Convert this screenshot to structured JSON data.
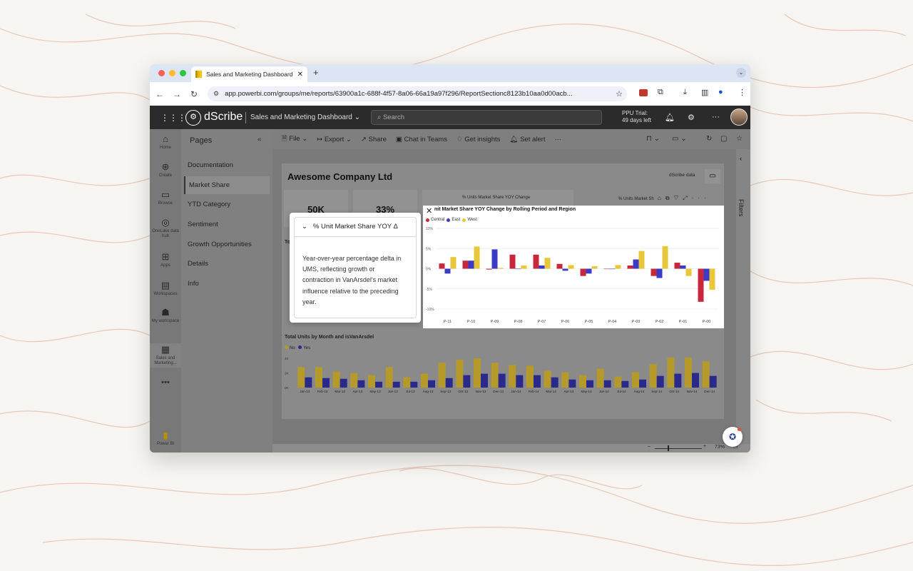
{
  "browser": {
    "tab_title": "Sales and Marketing Dashboard",
    "url": "app.powerbi.com/groups/me/reports/63900a1c-688f-4f57-8a06-66a19a97f296/ReportSectionc8123b10aa0d00acb..."
  },
  "header": {
    "brand": "dScribe",
    "report_name": "Sales and Marketing Dashboard",
    "search_placeholder": "Search",
    "trial_line1": "PPU Trial:",
    "trial_line2": "49 days left"
  },
  "rail": [
    {
      "label": "Home",
      "icon": "home-icon"
    },
    {
      "label": "Create",
      "icon": "create-icon"
    },
    {
      "label": "Browse",
      "icon": "browse-icon"
    },
    {
      "label": "OneLake data hub",
      "icon": "onelake-icon"
    },
    {
      "label": "Apps",
      "icon": "apps-icon"
    },
    {
      "label": "Workspaces",
      "icon": "workspaces-icon"
    },
    {
      "label": "My workspace",
      "icon": "my-workspace-icon"
    },
    {
      "label": "Sales and Marketing...",
      "icon": "report-icon"
    },
    {
      "label": "Power BI",
      "icon": "powerbi-icon"
    }
  ],
  "pages": {
    "title": "Pages",
    "items": [
      "Documentation",
      "Market Share",
      "YTD Category",
      "Sentiment",
      "Growth Opportunities",
      "Details",
      "Info"
    ],
    "active": "Market Share"
  },
  "report_toolbar": {
    "file": "File",
    "export": "Export",
    "share": "Share",
    "chat": "Chat in Teams",
    "insights": "Get insights",
    "alert": "Set alert"
  },
  "report": {
    "company": "Awesome Company Ltd",
    "dscribe_data": "dScribe data",
    "card1_value": "50K",
    "card2_value": "33%",
    "card3_title": "% Units Market Share YOY Change",
    "card4_title": "% Units Market Sh",
    "left_label": "To",
    "bottom_title": "Total Units by Month and isVanArsdel",
    "filters": "Filters",
    "zoom": "73%"
  },
  "tooltip": {
    "header": "% Unit Market Share YOY Δ",
    "description": "Year-over-year percentage delta in UMS, reflecting growth or contraction in VanArsdel's market influence relative to the preceding year."
  },
  "focus_chart": {
    "title": "nit Market Share YOY Change by Rolling Period and Region"
  },
  "colors": {
    "central": "#c8283c",
    "east": "#3b3bc7",
    "west": "#e9c73a",
    "no": "#b59a2a",
    "yes": "#2a2a8c"
  },
  "chart_data": [
    {
      "type": "bar",
      "title": "nit Market Share YOY Change by Rolling Period and Region",
      "categories": [
        "P-11",
        "P-10",
        "P-09",
        "P-08",
        "P-07",
        "P-06",
        "P-05",
        "P-04",
        "P-03",
        "P-02",
        "P-01",
        "P-00"
      ],
      "series": [
        {
          "name": "Central",
          "values": [
            1.3,
            2.0,
            -0.2,
            3.5,
            3.5,
            1.2,
            -1.8,
            0.0,
            0.8,
            -1.8,
            1.5,
            -8.2
          ]
        },
        {
          "name": "East",
          "values": [
            -1.2,
            2.0,
            4.8,
            0.0,
            0.8,
            -0.5,
            -1.2,
            0.0,
            2.3,
            -2.3,
            0.8,
            -3.0
          ]
        },
        {
          "name": "West",
          "values": [
            2.9,
            5.5,
            0.2,
            0.8,
            2.7,
            0.9,
            0.6,
            0.9,
            4.4,
            5.6,
            -1.8,
            -5.2
          ]
        }
      ],
      "yticks": [
        "10%",
        "5%",
        "0%",
        "-5%",
        "-10%"
      ],
      "ylim": [
        -10,
        10
      ]
    },
    {
      "type": "bar",
      "title": "Total Units by Month and isVanArsdel",
      "categories": [
        "Jan-13",
        "Feb-13",
        "Mar-13",
        "Apr-13",
        "May-13",
        "Jun-13",
        "Jul-13",
        "Aug-13",
        "Sep-13",
        "Oct-13",
        "Nov-13",
        "Dec-13",
        "Jan-14",
        "Feb-14",
        "Mar-14",
        "Apr-14",
        "May-14",
        "Jun-14",
        "Jul-14",
        "Aug-14",
        "Sep-14",
        "Oct-14",
        "Nov-14",
        "Dec-14"
      ],
      "series": [
        {
          "name": "No",
          "values": [
            28,
            28,
            22,
            20,
            17,
            28,
            14,
            19,
            34,
            38,
            40,
            34,
            31,
            30,
            23,
            21,
            17,
            26,
            15,
            21,
            32,
            41,
            41,
            36
          ]
        },
        {
          "name": "Yes",
          "values": [
            14,
            13,
            12,
            10,
            8,
            8,
            8,
            10,
            13,
            17,
            19,
            19,
            17,
            17,
            14,
            11,
            10,
            10,
            9,
            11,
            16,
            19,
            20,
            16
          ]
        }
      ],
      "yticks": [
        "4K",
        "2K",
        "0K"
      ],
      "ylim": [
        0,
        45
      ]
    }
  ]
}
